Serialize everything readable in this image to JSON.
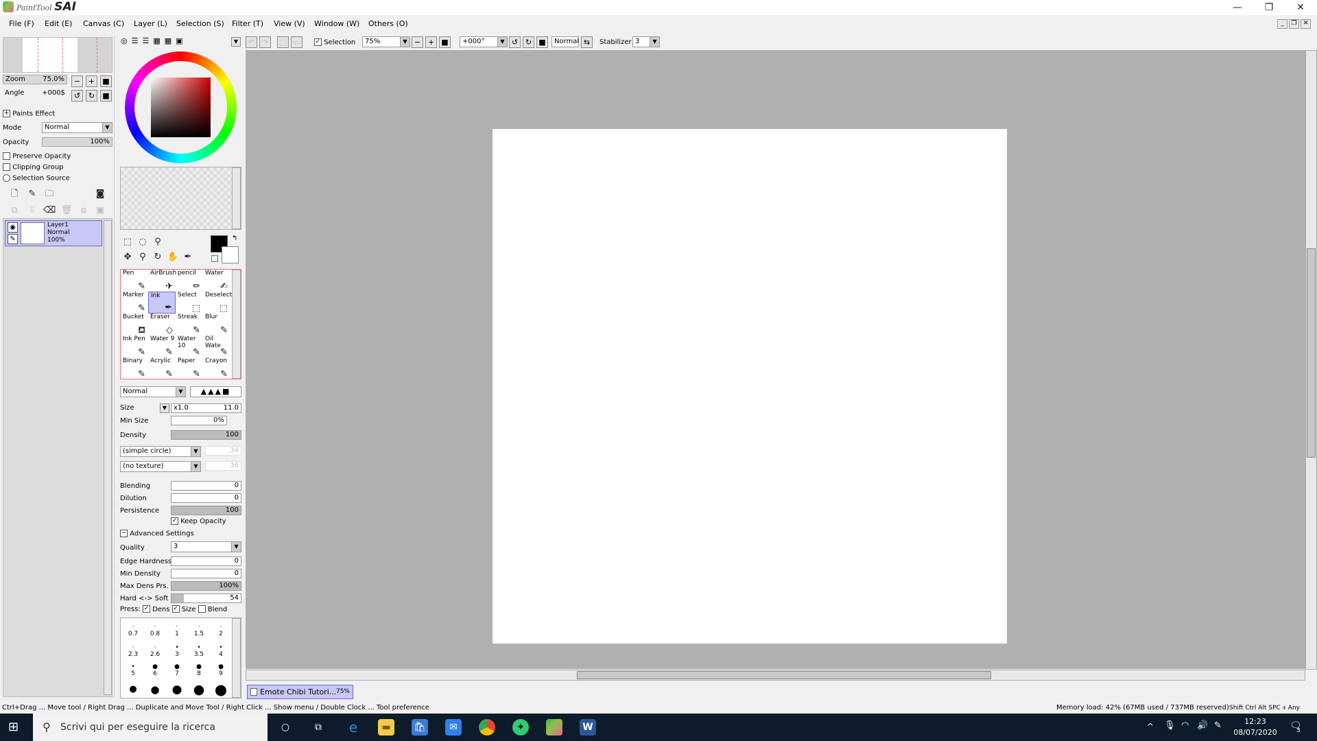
{
  "titlebar": {
    "app_small": "PaintTool",
    "app_big": "SAI",
    "minimize": "—",
    "restore": "❐",
    "close": "✕"
  },
  "menu": [
    "File (F)",
    "Edit (E)",
    "Canvas (C)",
    "Layer (L)",
    "Selection (S)",
    "Filter (T)",
    "View (V)",
    "Window (W)",
    "Others (O)"
  ],
  "navigator": {
    "zoom_label": "Zoom",
    "zoom_value": "75.0%",
    "angle_label": "Angle",
    "angle_value": "+000$"
  },
  "layer_props": {
    "paints_effect": "Paints Effect",
    "mode_label": "Mode",
    "mode_value": "Normal",
    "opacity_label": "Opacity",
    "opacity_value": "100%",
    "preserve_opacity": "Preserve Opacity",
    "clipping_group": "Clipping Group",
    "selection_source": "Selection Source"
  },
  "layers": [
    {
      "name": "Layer1",
      "mode": "Normal",
      "opacity": "100%"
    }
  ],
  "tool_toolbar": {
    "selection_label": "Selection",
    "zoom_value": "75%",
    "angle_value": "+000°",
    "blend_value": "Normal",
    "stabilizer_label": "Stabilizer",
    "stabilizer_value": "3"
  },
  "brushes": [
    [
      "Pen",
      "AirBrush",
      "pencil",
      "Water"
    ],
    [
      "Marker",
      "ink",
      "Select",
      "Deselect"
    ],
    [
      "Bucket",
      "Eraser",
      "Streak",
      "Blur"
    ],
    [
      "Ink Pen",
      "Water 9",
      "Water 10",
      "Oil Wate"
    ],
    [
      "Binary",
      "Acrylic",
      "Paper",
      "Crayon"
    ]
  ],
  "brush_settings": {
    "blend_mode": "Normal",
    "size_label": "Size",
    "size_mult": "x1.0",
    "size_value": "11.0",
    "minsize_label": "Min Size",
    "minsize_value": "0%",
    "density_label": "Density",
    "density_value": "100",
    "shape_value": "(simple circle)",
    "shape_num": "34",
    "texture_value": "(no texture)",
    "texture_num": "36",
    "blending_label": "Blending",
    "blending_value": "0",
    "dilution_label": "Dilution",
    "dilution_value": "0",
    "persistence_label": "Persistence",
    "persistence_value": "100",
    "keep_opacity": "Keep Opacity",
    "advanced": "Advanced Settings",
    "quality_label": "Quality",
    "quality_value": "3",
    "edge_label": "Edge Hardness",
    "edge_value": "0",
    "mindens_label": "Min Density",
    "mindens_value": "0",
    "maxdens_label": "Max Dens Prs.",
    "maxdens_value": "100%",
    "hardsoft_label": "Hard <-> Soft",
    "hardsoft_value": "54",
    "press_label": "Press:",
    "press_dens": "Dens",
    "press_size": "Size",
    "press_blend": "Blend"
  },
  "brush_sizes": [
    [
      "0.7",
      "0.8",
      "1",
      "1.5",
      "2"
    ],
    [
      "2.3",
      "2.6",
      "3",
      "3.5",
      "4"
    ],
    [
      "5",
      "6",
      "7",
      "8",
      "9"
    ]
  ],
  "document_tab": {
    "name": "Emote Chibi Tutori...",
    "zoom": "75%"
  },
  "status": {
    "hint": "Ctrl+Drag ... Move tool / Right Drag ... Duplicate and Move Tool / Right Click ... Show menu / Double Clock ... Tool preference",
    "memory": "Memory load: 42% (67MB used / 737MB reserved)",
    "keys": "Shift Ctrl Alt SPC ⌽ Any"
  },
  "taskbar": {
    "search_placeholder": "Scrivi qui per eseguire la ricerca",
    "time": "12:23",
    "date": "08/07/2020",
    "notif_count": "3"
  },
  "colors": {
    "accent_select": "#c8c8f5",
    "canvas_bg": "#b0b0b0",
    "taskbar": "#0d1b2a"
  }
}
